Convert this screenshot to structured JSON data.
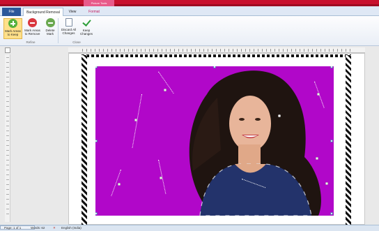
{
  "titlebar": {
    "context_tab": "Picture Tools"
  },
  "tabs": [
    {
      "label": "File"
    },
    {
      "label": "Background Removal"
    },
    {
      "label": "View"
    },
    {
      "label": "Format"
    }
  ],
  "ribbon": {
    "mark_keep": "Mark Areas to Keep",
    "mark_remove": "Mark Areas to Remove",
    "delete_mark": "Delete Mark",
    "discard": "Discard All Changes",
    "keep_changes": "Keep Changes",
    "group_refine": "Refine",
    "group_close": "Close"
  },
  "status": {
    "page": "Page: 1 of 1",
    "words": "Words: 62",
    "language": "English (India)"
  },
  "colors": {
    "background_removed_fill": "#b107c9",
    "accent": "#2b579a"
  }
}
